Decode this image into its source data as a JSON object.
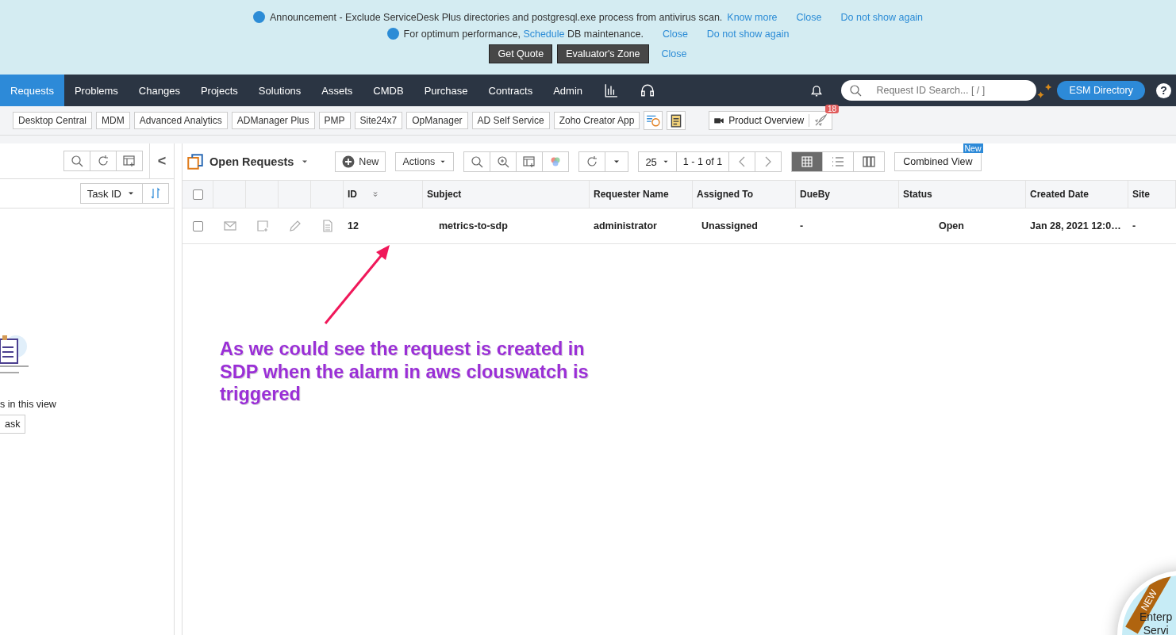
{
  "announcements": [
    {
      "text": "Announcement - Exclude ServiceDesk Plus directories and postgresql.exe process from antivirus scan.",
      "link": "Know more",
      "close": "Close",
      "dismiss": "Do not show again"
    },
    {
      "text_before": "For optimum performance,",
      "link": "Schedule",
      "text_after": "DB maintenance.",
      "close": "Close",
      "dismiss": "Do not show again"
    }
  ],
  "trial_bar": {
    "buttons": [
      "Get Quote",
      "Evaluator's Zone"
    ],
    "close": "Close"
  },
  "nav": {
    "tabs": [
      {
        "label": "Requests",
        "selected": true
      },
      {
        "label": "Problems",
        "selected": false
      },
      {
        "label": "Changes",
        "selected": false
      },
      {
        "label": "Projects",
        "selected": false
      },
      {
        "label": "Solutions",
        "selected": false
      },
      {
        "label": "Assets",
        "selected": false
      },
      {
        "label": "CMDB",
        "selected": false
      },
      {
        "label": "Purchase",
        "selected": false
      },
      {
        "label": "Contracts",
        "selected": false
      },
      {
        "label": "Admin",
        "selected": false
      }
    ],
    "search": {
      "placeholder": "Request ID Search... [ / ]"
    },
    "esm_button": "ESM Directory",
    "help": "?"
  },
  "integrations": [
    "Desktop Central",
    "MDM",
    "Advanced Analytics",
    "ADManager Plus",
    "PMP",
    "Site24x7",
    "OpManager",
    "AD Self Service",
    "Zoho Creator App"
  ],
  "product_overview": {
    "label": "Product Overview",
    "count": "18"
  },
  "left_panel": {
    "collapse": "<",
    "sort_field": "Task ID",
    "empty_text": "s in this view",
    "add_button": "ask"
  },
  "requests": {
    "view_title": "Open Requests",
    "new_button": "New",
    "actions_button": "Actions",
    "page_size": "25",
    "range": "1 - 1 of 1",
    "views": [
      {
        "kind": "grid",
        "selected": true
      },
      {
        "kind": "list",
        "selected": false
      },
      {
        "kind": "columns",
        "selected": false
      }
    ],
    "combined_view": "Combined View",
    "new_badge": "New",
    "columns": [
      "ID",
      "Subject",
      "Requester Name",
      "Assigned To",
      "DueBy",
      "Status",
      "Created Date",
      "Site"
    ],
    "rows": [
      {
        "checked": false,
        "cells": [
          "12",
          "metrics-to-sdp",
          "administrator",
          "Unassigned",
          "-",
          "Open",
          "Jan 28, 2021 12:0…",
          "-"
        ]
      }
    ],
    "header_checked": false
  },
  "annotation": "As we could see the request is created in SDP when the alarm in aws clouswatch is triggered",
  "promo": {
    "ribbon": "NEW",
    "lines": [
      "Enterp",
      "Servi"
    ]
  }
}
